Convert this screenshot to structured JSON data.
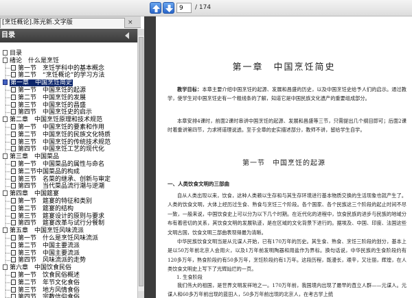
{
  "toolbar": {
    "current_page": "9",
    "total_pages": "/ 174",
    "prev_icon": "arrow-up-icon",
    "next_icon": "arrow-down-icon"
  },
  "tab": {
    "title": "[烹饪概论].陈光新.文字版",
    "close_label": "×"
  },
  "sidebar": {
    "title": "目录"
  },
  "toc": [
    {
      "label": "目录",
      "level": 0,
      "top": 0
    },
    {
      "label": "绪论　什么是烹饪",
      "level": 0
    },
    {
      "label": "第一节　烹饪学科中的基本概念",
      "level": 1
    },
    {
      "label": "第二节　“烹饪概论”的学习方法",
      "level": 1
    },
    {
      "label": "第一章　中国烹饪简史",
      "level": 0,
      "selected": true
    },
    {
      "label": "第一节　中国烹饪的起源",
      "level": 1
    },
    {
      "label": "第二节　中国烹饪的发展",
      "level": 1
    },
    {
      "label": "第三节　中国烹饪的昌盛",
      "level": 1
    },
    {
      "label": "第四节　中国烹饪史的启示",
      "level": 1
    },
    {
      "label": "第二章　中国烹饪原理和技术规范",
      "level": 0
    },
    {
      "label": "第一节　中国烹饪的要素和作用",
      "level": 1
    },
    {
      "label": "第二节　中国烹饪的民族文化特质",
      "level": 1
    },
    {
      "label": "第三节　中国烹饪的传统技术规范",
      "level": 1
    },
    {
      "label": "第四节　中国烹饪工艺的现代化",
      "level": 1
    },
    {
      "label": "第三章　中国菜品",
      "level": 0
    },
    {
      "label": "第一节　中国菜品的属性与命名",
      "level": 1
    },
    {
      "label": "第二节中国菜品的构成",
      "level": 1
    },
    {
      "label": "第三节　名菜的继承、创新与审定",
      "level": 1
    },
    {
      "label": "第四节　当代菜品流行潮与逆潮",
      "level": 1
    },
    {
      "label": "第四章　中国筵宴",
      "level": 0
    },
    {
      "label": "第一节　筵宴的特征和类别",
      "level": 1
    },
    {
      "label": "第二节　筵宴的结构",
      "level": 1
    },
    {
      "label": "第三节　筵宴设计的原则与要求",
      "level": 1
    },
    {
      "label": "第四节　筵宴改革与试行分餐制",
      "level": 1
    },
    {
      "label": "第五章　中国烹饪风味流派",
      "level": 0
    },
    {
      "label": "第一节　什么是烹饪风味流派",
      "level": 1
    },
    {
      "label": "第二节　中国主要流派",
      "level": 1
    },
    {
      "label": "第三节　中国主要流派",
      "level": 1
    },
    {
      "label": "第四节　风味流派的走势",
      "level": 1
    },
    {
      "label": "第六章　中国饮食民俗",
      "level": 0
    },
    {
      "label": "第一节　饮食民俗概述",
      "level": 1
    },
    {
      "label": "第二节　年节文化食俗",
      "level": 1
    },
    {
      "label": "第三节　地方风情食俗",
      "level": 1
    },
    {
      "label": "第四节　宗教信仰食俗",
      "level": 1
    },
    {
      "label": "第五节　少数民族食俗",
      "level": 1
    }
  ],
  "document": {
    "chapter_title": "第一章　中国烹饪简史",
    "objective_label": "教学目标：",
    "objective_text": "本章主要介绍中国烹饪的起源、发展和昌盛的历史，以及中国烹饪史给予人们的启示。通过教学，使学生对中国烹饪史有一个粗线条的了解，知道它是中国民族文化遗产的重要组成部分。",
    "arrangement": "本章安排4课时，前面2课时串讲中国烹饪的起源、发展和昌盛等三节，只需提出几个纲目即可；后面2课时着重讲第四节，力求将道理说透。至于全章的史实描述部分，教师不讲，留给学生自学。",
    "section_title": "第一节　中国烹饪的起源",
    "subheading": "一、人类饮食文明的三部曲",
    "para1": "自从人类出现以来，饮食，这种人类赖以生存和与其生存环境进行基本物质交换的生活现象也就产生了。人类的饮食文明，大体上经历过生食、熟食与烹饪三个阶段。各个国家、各个民族这三个阶段的起止时间不尽一致，一般来说，中国饮食史上可以分为以下几个时期。在近代化的进程中，饮食民族的进步与民族的地域分布有着密切的关系，其饮食文明的发展轨迹，是在区域的文化背景下进行的。据埃及、中国、印度、法国这些文明古国，饮食文明三部曲表现得最为清晰。",
    "para2": "中华民族饮食文明当是从元谋人开始，已有170万年的历史。其生食、熟食、烹饪三阶段的划分，基本上是以50万年前北京人会用火，以及1万年前发明陶器和用盐作为界标。换句话说，中华民族的生食阶段约有120多万年，熟食阶段约有50多万年，烹饪阶段约有1万年。这段历程，既漫长，艰辛，又壮丽，辉煌，在人类饮食文明史上写下了光辉灿烂的一页。",
    "subsub": "1. 生食阶段",
    "para3": "我们伟大的祖国，是世界文明发祥地之一。170万年前，我国境内出现了最早的直立人群——元谋人。元谋人和60多万年前出现的蓝田人，50多万年前出现的北京人，在考古学上统"
  }
}
